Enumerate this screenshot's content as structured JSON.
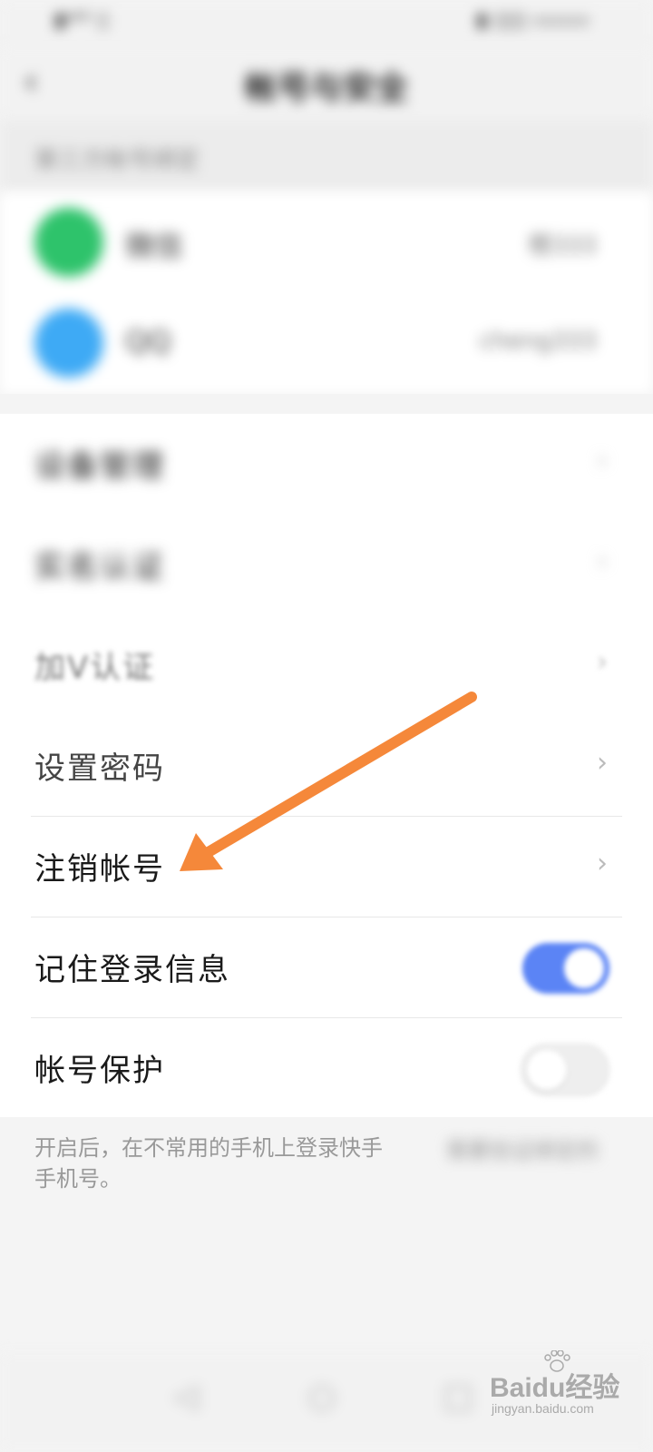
{
  "status_bar": {
    "left": "▮ᵍ⁴ᴳ ▯",
    "right": "▮ ▯▯▯ ▭▭▭"
  },
  "nav": {
    "title": "帐号与安全"
  },
  "section": {
    "title": "第三方帐号绑定"
  },
  "bindings": [
    {
      "name": "微信",
      "value": "橙333",
      "color": "#2ec36b"
    },
    {
      "name": "QQ",
      "value": "cheng333",
      "color": "#3eaaf5"
    }
  ],
  "list": [
    {
      "label": "设备管理",
      "type": "chevron",
      "blur": "strong"
    },
    {
      "label": "实名认证",
      "type": "chevron",
      "blur": "strong"
    },
    {
      "label": "加V认证",
      "type": "chevron",
      "blur": "soft"
    },
    {
      "label": "设置密码",
      "type": "chevron",
      "blur": "none"
    },
    {
      "label": "注销帐号",
      "type": "chevron",
      "blur": "none"
    },
    {
      "label": "记住登录信息",
      "type": "toggle",
      "on": true,
      "blur": "none"
    },
    {
      "label": "帐号保护",
      "type": "toggle",
      "on": false,
      "blur": "none"
    }
  ],
  "hint": {
    "line1": "开启后，在不常用的手机上登录快手",
    "line2": "手机号。",
    "right": "需要验证绑定的"
  },
  "annotation": {
    "arrow_color": "#f5883a"
  },
  "watermark": {
    "main": "Baidu经验",
    "sub": "jingyan.baidu.com"
  },
  "colors": {
    "accent": "#5b84f5",
    "wechat": "#2ec36b",
    "qq": "#3eaaf5"
  }
}
